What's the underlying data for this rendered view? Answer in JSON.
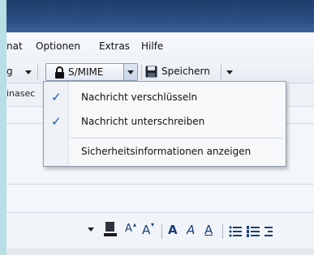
{
  "menubar": {
    "items": [
      {
        "label": "nat"
      },
      {
        "label": "Optionen"
      },
      {
        "label": "Extras"
      },
      {
        "label": "Hilfe"
      }
    ]
  },
  "toolbar": {
    "left_fragment": "g",
    "smime_label": "S/MIME",
    "save_label": "Speichern"
  },
  "fields": {
    "fragment_label": "inasec"
  },
  "dropdown": {
    "items": [
      {
        "label": "Nachricht verschlüsseln",
        "checked": true
      },
      {
        "label": "Nachricht unterschreiben",
        "checked": true
      },
      {
        "label": "Sicherheitsinformationen anzeigen",
        "checked": false
      }
    ],
    "checkmark": "✓"
  },
  "formatbar": {
    "grow_font": "A",
    "shrink_font": "A",
    "bold": "A",
    "italic": "A",
    "underline": "A"
  },
  "colors": {
    "titlebar": "#2d5288",
    "background": "#b6dfe6",
    "check": "#1b53a6"
  }
}
